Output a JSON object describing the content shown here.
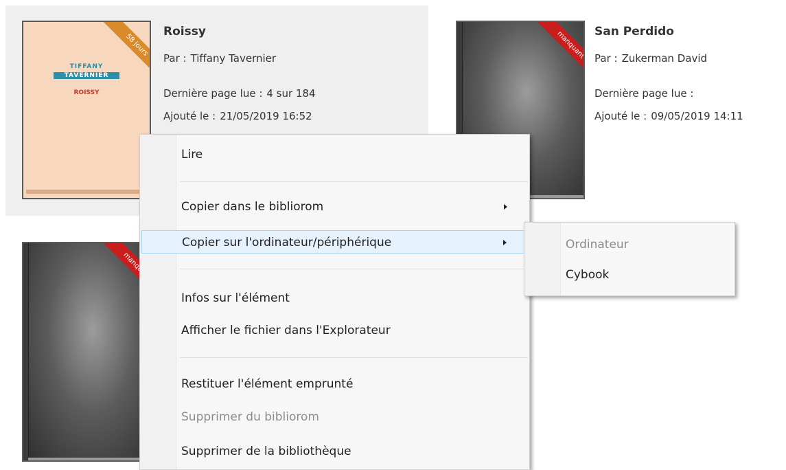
{
  "books": [
    {
      "title": "Roissy",
      "author_label": "Par :",
      "author": "Tiffany Tavernier",
      "lastpage_label": "Dernière page lue :",
      "lastpage": "4 sur 184",
      "added_label": "Ajouté le :",
      "added": "21/05/2019 16:52",
      "ribbon": "58 jours",
      "cover_lines": [
        "TIFFANY",
        "TAVERNIER",
        "ROISSY"
      ]
    },
    {
      "title": "San Perdido",
      "author_label": "Par :",
      "author": "Zukerman David",
      "lastpage_label": "Dernière page lue :",
      "lastpage": "",
      "added_label": "Ajouté le :",
      "added": "09/05/2019 14:11",
      "ribbon": "manquant"
    },
    {
      "ribbon": "manquant"
    }
  ],
  "context_menu": {
    "read": "Lire",
    "copy_bibliorom": "Copier dans le bibliorom",
    "copy_device": "Copier sur l'ordinateur/périphérique",
    "item_info": "Infos sur l'élément",
    "show_in_explorer": "Afficher le fichier dans l'Explorateur",
    "return_borrowed": "Restituer l'élément emprunté",
    "delete_bibliorom": "Supprimer du bibliorom",
    "delete_library": "Supprimer de la bibliothèque"
  },
  "submenu": {
    "computer": "Ordinateur",
    "cybook": "Cybook"
  },
  "colors": {
    "ribbon_orange": "#d98a2b",
    "ribbon_red": "#c81e1e",
    "hover_bg": "#e5f1fb",
    "hover_border": "#a9d3f3"
  }
}
